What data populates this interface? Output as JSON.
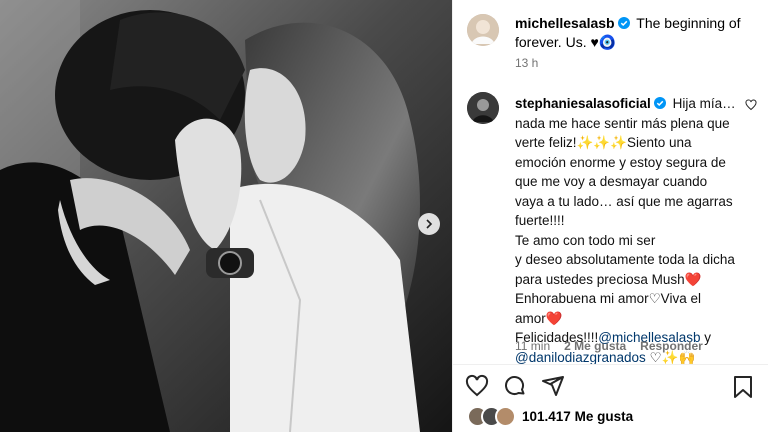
{
  "post": {
    "author": "michellesalasb",
    "caption_text": "The beginning of forever. Us. ♥🧿",
    "caption_time": "13 h",
    "photo_alt": "Black and white photo of a couple kissing"
  },
  "comment": {
    "author": "stephaniesalasoficial",
    "line1": "Hija mía…",
    "line2": "nada me hace sentir más plena que",
    "line3": "verte feliz!✨✨✨Siento una",
    "line4": "emoción enorme y estoy segura de",
    "line5": "que me voy a desmayar cuando",
    "line6": "vaya a tu lado… así que me agarras",
    "line7": "fuerte!!!!",
    "line8": "Te amo con todo mi ser",
    "line9": "y deseo absolutamente toda la dicha",
    "line10": "para ustedes preciosa Mush❤️",
    "line11": "Enhorabuena mi amor♡Viva el",
    "line12": "amor❤️",
    "line13_prefix": "Felicidades!!!!",
    "mention1": "@michellesalasb",
    "line13_suffix": " y",
    "mention2": "@danilodiazgranados",
    "line14_suffix": " ♡✨🙌",
    "time": "11 min",
    "likes": "2 Me gusta",
    "reply": "Responder"
  },
  "footer": {
    "likes_count": "101.417",
    "likes_label": "Me gusta"
  },
  "icons": {
    "like": "heart-icon",
    "comment": "comment-icon",
    "share": "share-icon",
    "save": "bookmark-icon",
    "next": "chevron-right-icon"
  },
  "colors": {
    "verified": "#0095f6",
    "mention": "#00376b",
    "muted": "#737373"
  }
}
